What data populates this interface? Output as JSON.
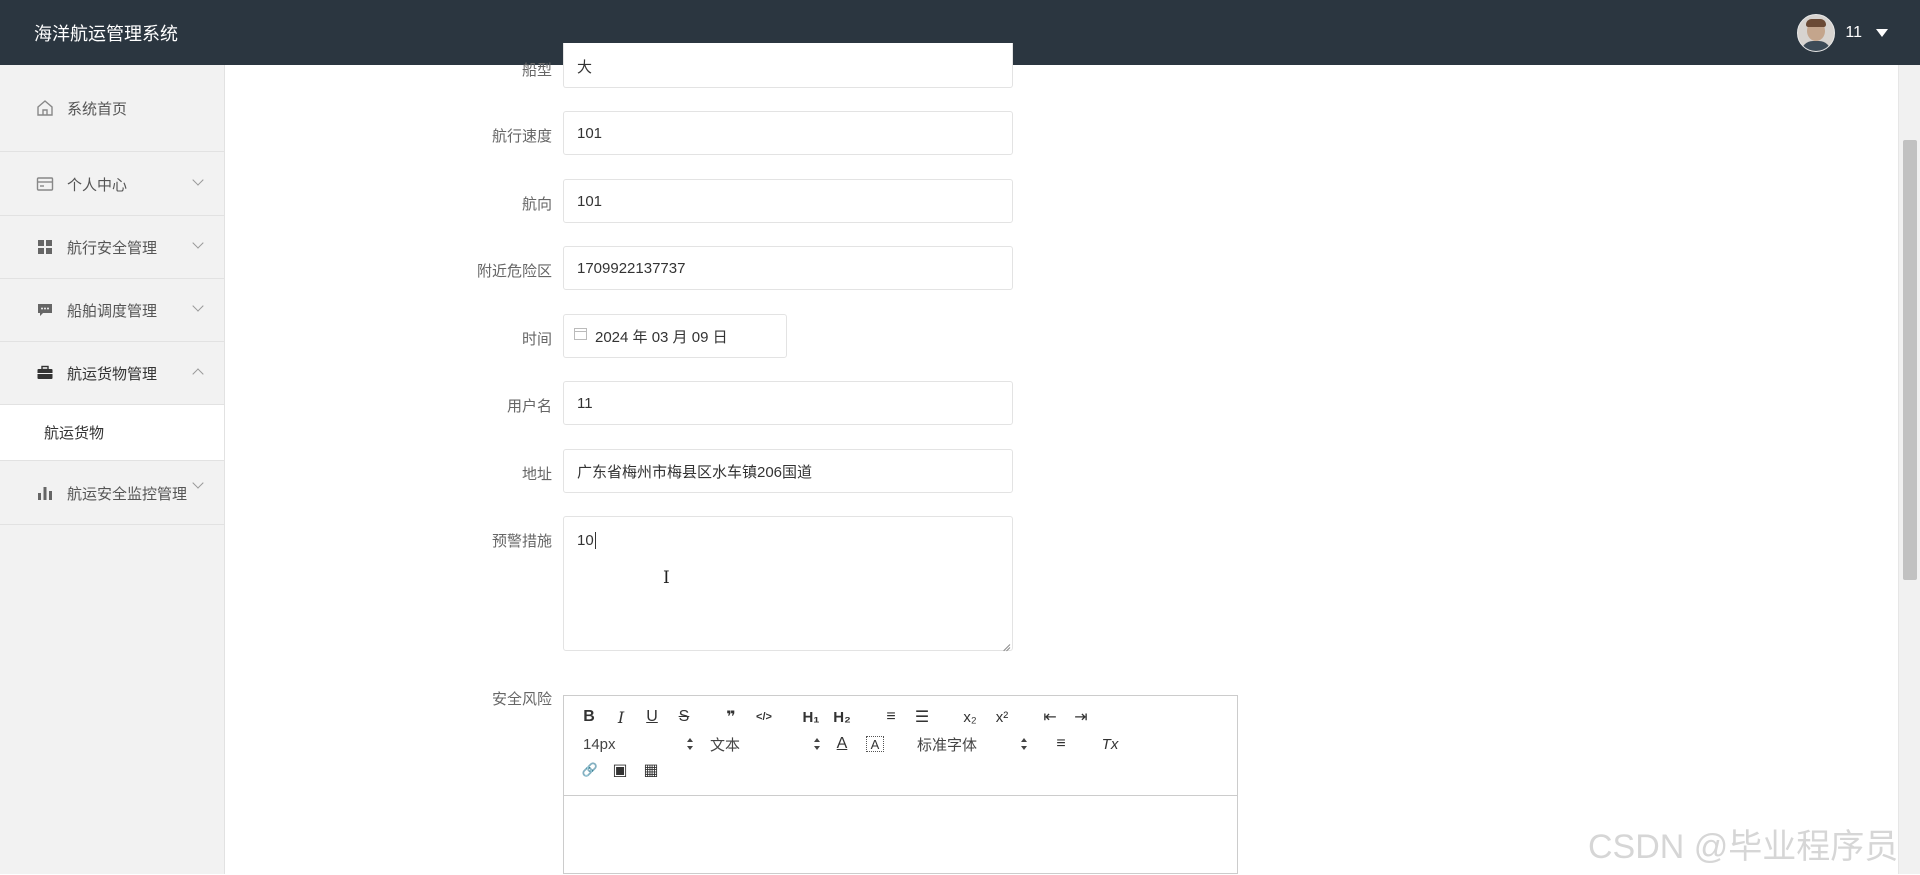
{
  "header": {
    "title": "海洋航运管理系统",
    "user_name": "11"
  },
  "sidebar": {
    "items": [
      {
        "label": "系统首页",
        "icon": "home-icon"
      },
      {
        "label": "个人中心",
        "icon": "wallet-icon"
      },
      {
        "label": "航行安全管理",
        "icon": "grid-icon"
      },
      {
        "label": "船舶调度管理",
        "icon": "chat-icon"
      },
      {
        "label": "航运货物管理",
        "icon": "briefcase-icon"
      },
      {
        "label": "航运安全监控管理",
        "icon": "bar-chart-icon"
      }
    ],
    "subitem": "航运货物"
  },
  "form": {
    "ship_type": {
      "label": "船型",
      "value": "大"
    },
    "speed": {
      "label": "航行速度",
      "value": "101"
    },
    "heading": {
      "label": "航向",
      "value": "101"
    },
    "danger_zone": {
      "label": "附近危险区",
      "value": "1709922137737"
    },
    "time": {
      "label": "时间",
      "value": "2024 年 03 月 09 日"
    },
    "username": {
      "label": "用户名",
      "value": "11"
    },
    "address": {
      "label": "地址",
      "value": "广东省梅州市梅县区水车镇206国道"
    },
    "warning": {
      "label": "预警措施",
      "value": "10"
    },
    "risk": {
      "label": "安全风险"
    }
  },
  "editor": {
    "buttons": {
      "bold": "B",
      "italic": "I",
      "underline": "U",
      "strike": "S",
      "quote": "❞",
      "code": "</>",
      "h1": "H₁",
      "h2": "H₂",
      "ordered_list": "≡",
      "bullet_list": "☰",
      "subscript": "x₂",
      "superscript": "x²",
      "outdent": "⇤",
      "indent": "⇥",
      "color": "A",
      "background": "A",
      "align": "≡",
      "clean": "Tx",
      "link": "🔗",
      "image": "▣",
      "video": "▦"
    },
    "size_select": "14px",
    "header_select": "文本",
    "font_select": "标准字体"
  },
  "watermark": "CSDN @毕业程序员",
  "colors": {
    "topbar": "#2b3640",
    "sidebar": "#f2f2f2"
  }
}
